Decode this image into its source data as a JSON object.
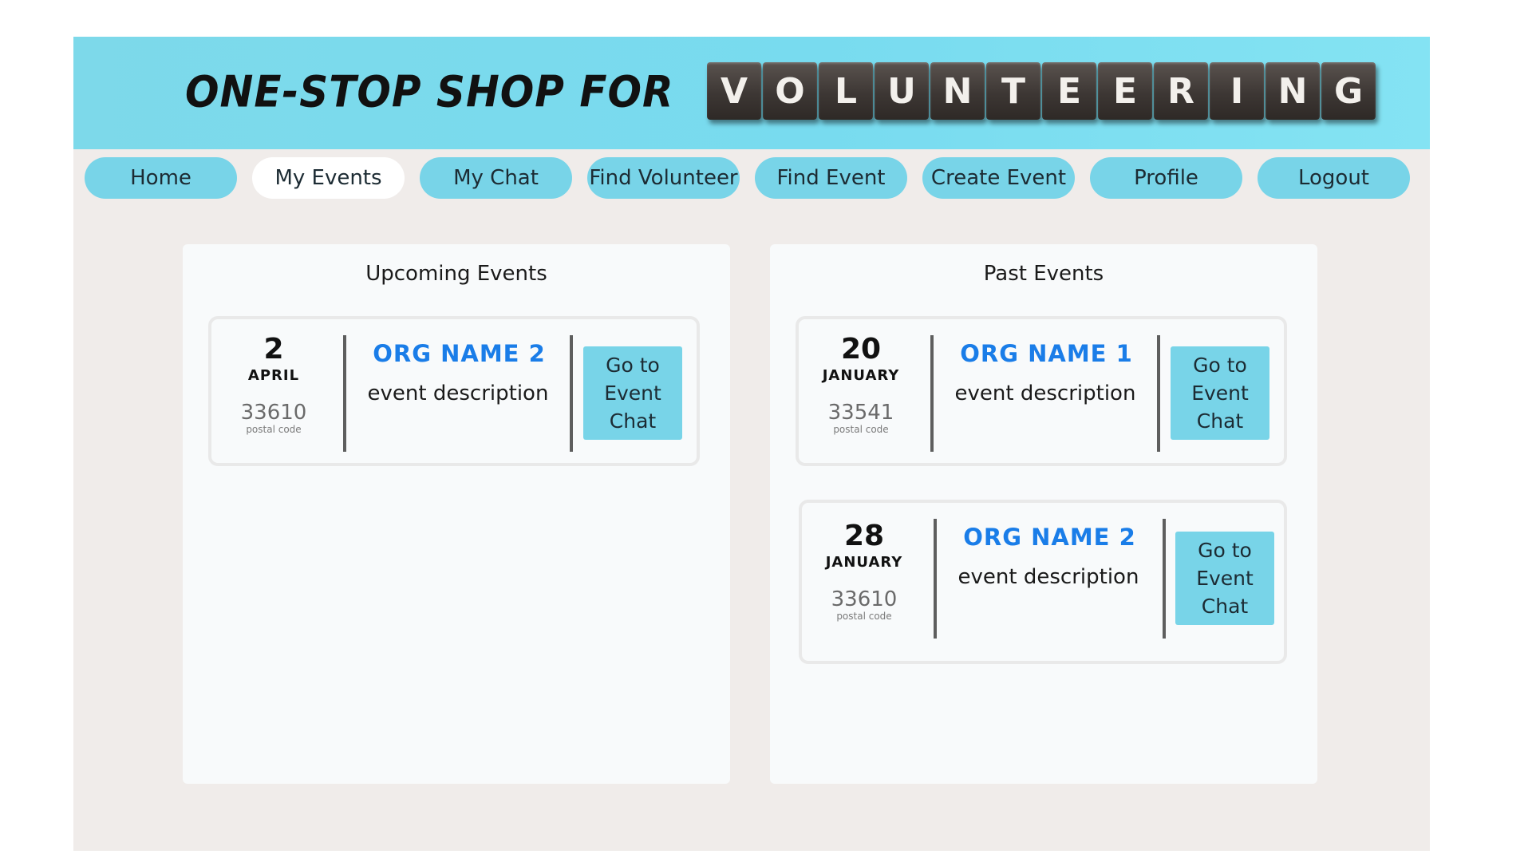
{
  "header": {
    "title": "ONE-STOP SHOP FOR",
    "tiles": [
      "V",
      "O",
      "L",
      "U",
      "N",
      "T",
      "E",
      "E",
      "R",
      "I",
      "N",
      "G"
    ]
  },
  "nav": {
    "items": [
      {
        "label": "Home"
      },
      {
        "label": "My Events",
        "active": true
      },
      {
        "label": "My Chat"
      },
      {
        "label": "Find Volunteer"
      },
      {
        "label": "Find Event"
      },
      {
        "label": "Create Event"
      },
      {
        "label": "Profile"
      },
      {
        "label": "Logout"
      }
    ]
  },
  "upcoming": {
    "title": "Upcoming Events",
    "events": [
      {
        "day": "2",
        "month": "APRIL",
        "postal": "33610",
        "postal_label": "postal code",
        "org": "ORG NAME 2",
        "description": "event description",
        "button": [
          "Go to",
          "Event",
          "Chat"
        ]
      }
    ]
  },
  "past": {
    "title": "Past Events",
    "events": [
      {
        "day": "20",
        "month": "JANUARY",
        "postal": "33541",
        "postal_label": "postal code",
        "org": "ORG NAME 1",
        "description": "event description",
        "button": [
          "Go to",
          "Event",
          "Chat"
        ]
      },
      {
        "day": "28",
        "month": "JANUARY",
        "postal": "33610",
        "postal_label": "postal code",
        "org": "ORG NAME 2",
        "description": "event description",
        "button": [
          "Go to",
          "Event",
          "Chat"
        ]
      }
    ]
  },
  "colors": {
    "header_bg": "#7dd9ea",
    "nav_button": "#78d4e8",
    "nav_active": "#ffffff",
    "page_bg": "#f0ecea",
    "org_name": "#1a7de8"
  }
}
